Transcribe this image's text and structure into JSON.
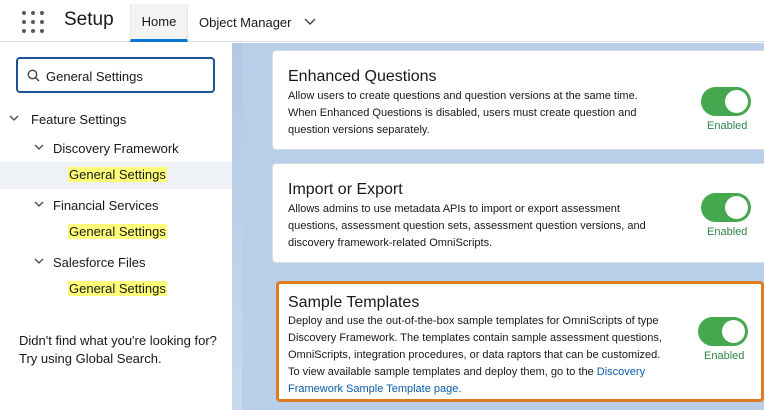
{
  "header": {
    "app_name": "Setup",
    "tabs": [
      {
        "label": "Home"
      },
      {
        "label": "Object Manager"
      }
    ]
  },
  "sidebar": {
    "search_value": "General Settings",
    "tree": {
      "feature_settings": "Feature Settings",
      "discovery_framework": "Discovery Framework",
      "df_general": "General Settings",
      "financial_services": "Financial Services",
      "fs_general": "General Settings",
      "salesforce_files": "Salesforce Files",
      "sf_general": "General Settings"
    },
    "help_line1": "Didn't find what you're looking for?",
    "help_line2": "Try using Global Search."
  },
  "cards": [
    {
      "title": "Enhanced Questions",
      "desc_lines": [
        "Allow users to create questions and question versions at the same time.",
        "When Enhanced Questions is disabled, users must create question and",
        "question versions separately."
      ],
      "status": "Enabled",
      "enabled": true
    },
    {
      "title": "Import or Export",
      "desc_lines": [
        "Allows admins to use metadata APIs to import or export assessment",
        "questions, assessment question sets, assessment question versions, and",
        "discovery framework-related OmniScripts."
      ],
      "status": "Enabled",
      "enabled": true
    },
    {
      "title": "Sample Templates",
      "desc_lines": [
        "Deploy and use the out-of-the-box sample templates for OmniScripts of type",
        "Discovery Framework. The templates contain sample assessment questions,",
        "OmniScripts, integration procedures, or data raptors that can be customized.",
        "To view available sample templates and deploy them, go to the"
      ],
      "link_part1": "Discovery",
      "link_part2": "Framework Sample Template page.",
      "status": "Enabled",
      "enabled": true
    }
  ],
  "colors": {
    "toggle_on": "#45a84e",
    "highlight_border": "#e07a1e",
    "link": "#0b5cab",
    "search_highlight": "#ffff7a"
  }
}
